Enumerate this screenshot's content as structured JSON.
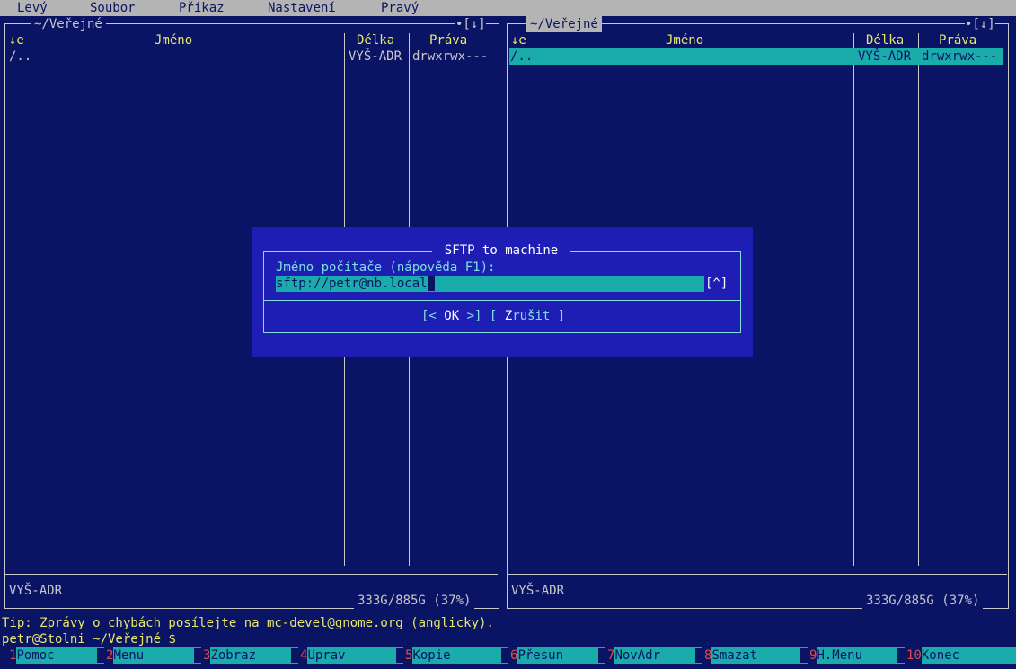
{
  "menu": [
    "Levý",
    "Soubor",
    "Příkaz",
    "Nastavení",
    "Pravý"
  ],
  "left_panel": {
    "path": "~/Veřejné",
    "corner": "•[↓]",
    "sort_indicator": "↓e",
    "columns": {
      "name": "Jméno",
      "size": "Délka",
      "perms": "Práva"
    },
    "rows": [
      {
        "name": "/..",
        "size": "VYŠ-ADR",
        "perms": "drwxrwx---"
      }
    ],
    "status": "VYŠ-ADR",
    "free": "333G/885G (37%)"
  },
  "right_panel": {
    "path": "~/Veřejné",
    "corner": "•[↓]",
    "sort_indicator": "↓e",
    "columns": {
      "name": "Jméno",
      "size": "Délka",
      "perms": "Práva"
    },
    "rows": [
      {
        "name": "/..",
        "size": "VYŠ-ADR",
        "perms": "drwxrwx---"
      }
    ],
    "status": "VYŠ-ADR",
    "free": "333G/885G (37%)"
  },
  "dialog": {
    "title": "SFTP to machine",
    "label": "Jméno počítače (nápověda F1):",
    "value": "sftp://petr@nb.local",
    "history_button": "[^]",
    "ok_pre": "[< ",
    "ok_label": "OK",
    "ok_post": " >]",
    "cancel_pre": "[ ",
    "cancel_hotkey": "Z",
    "cancel_rest": "rušit",
    "cancel_post": " ]"
  },
  "tip": "Tip: Zprávy o chybách posílejte na mc-devel@gnome.org (anglicky).",
  "prompt": "petr@Stolni ~/Veřejné $",
  "fkeys": [
    {
      "num": "1",
      "label": "Pomoc"
    },
    {
      "num": "2",
      "label": "Menu"
    },
    {
      "num": "3",
      "label": "Zobraz"
    },
    {
      "num": "4",
      "label": "Uprav"
    },
    {
      "num": "5",
      "label": "Kopie"
    },
    {
      "num": "6",
      "label": "Přesun"
    },
    {
      "num": "7",
      "label": "NovAdr"
    },
    {
      "num": "8",
      "label": "Smazat"
    },
    {
      "num": "9",
      "label": "H.Menu"
    },
    {
      "num": "10",
      "label": "Konec"
    }
  ]
}
